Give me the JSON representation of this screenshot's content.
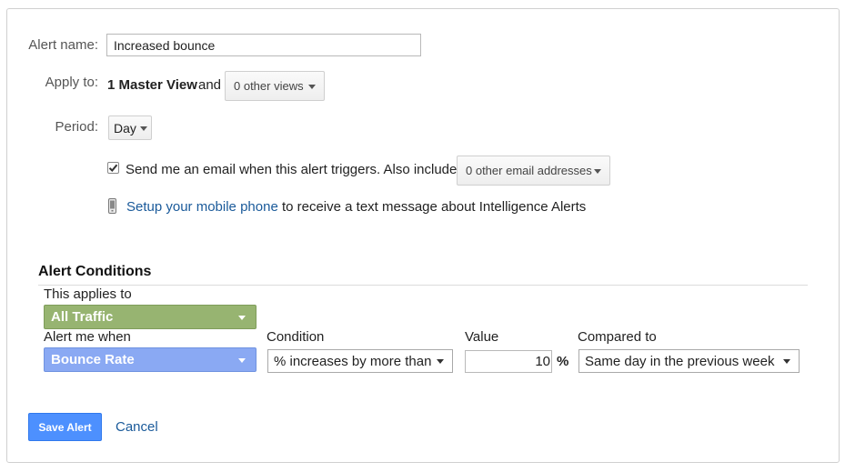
{
  "form": {
    "alert_name_label": "Alert name:",
    "alert_name_value": "Increased bounce",
    "apply_to_label": "Apply to:",
    "apply_to_view": "1 Master View",
    "apply_to_and": "and",
    "other_views": "0 other views",
    "period_label": "Period:",
    "period_value": "Day",
    "email_checked": true,
    "email_text": "Send me an email when this alert triggers. Also include",
    "other_emails": "0 other email addresses",
    "mobile_link": "Setup your mobile phone",
    "mobile_text": "to receive a text message about Intelligence Alerts"
  },
  "conditions": {
    "heading": "Alert Conditions",
    "applies_label": "This applies to",
    "applies_value": "All Traffic",
    "alert_when_label": "Alert me when",
    "alert_when_value": "Bounce Rate",
    "condition_label": "Condition",
    "condition_value": "% increases by more than",
    "value_label": "Value",
    "value_input": "10",
    "value_unit": "%",
    "compared_label": "Compared to",
    "compared_value": "Same day in the previous week"
  },
  "actions": {
    "save_label": "Save Alert",
    "cancel_label": "Cancel"
  },
  "colors": {
    "all_traffic": "#97b471",
    "bounce_rate": "#8aa9f3",
    "save_button": "#4d90fe",
    "link": "#1a5a9a"
  },
  "icons": {
    "checkbox": "check-icon",
    "phone": "mobile-phone-icon",
    "dropdown": "caret-down-icon"
  }
}
